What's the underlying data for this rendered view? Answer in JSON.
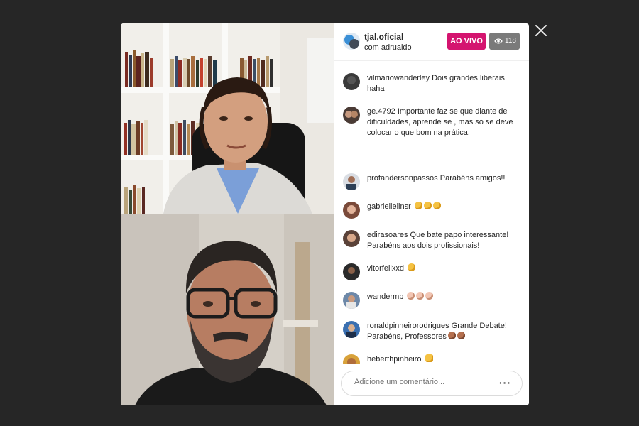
{
  "header": {
    "username": "tjal.oficial",
    "with_text": "com adrualdo",
    "live_label": "AO VIVO",
    "viewer_count": "118"
  },
  "comments": [
    {
      "user": "vilmariowanderley",
      "text": "Dois grandes liberais haha",
      "emoji": []
    },
    {
      "user": "ge.4792",
      "text": "Importante faz se que diante de dificuldades, aprende se , mas só se deve colocar o que bom na prática.",
      "emoji": []
    },
    {
      "user": "profandersonpassos",
      "text": "Parabéns amigos!!",
      "emoji": []
    },
    {
      "user": "gabriellelinsr",
      "text": "",
      "emoji": [
        "clap",
        "clap",
        "clap"
      ]
    },
    {
      "user": "edirasoares",
      "text": "Que bate papo interessante! Parabéns aos dois profissionais!",
      "emoji": []
    },
    {
      "user": "vitorfelixxd",
      "text": "",
      "emoji": [
        "clap"
      ]
    },
    {
      "user": "wandermb",
      "text": "",
      "emoji": [
        "clap-light",
        "clap-light",
        "clap-light"
      ]
    },
    {
      "user": "ronaldpinheirorodrigues",
      "text": "Grande Debate! Parabéns, Professores",
      "emoji": [
        "clap-dark",
        "clap-dark"
      ]
    },
    {
      "user": "heberthpinheiro",
      "text": "",
      "emoji": [
        "thumbs-up"
      ]
    }
  ],
  "input": {
    "placeholder": "Adicione um comentário..."
  },
  "icons": {
    "close": "close-icon",
    "viewers": "eye-icon",
    "more": "more-options-icon"
  },
  "colors": {
    "live": "#d4146f",
    "viewers_badge": "#7a7a7a",
    "backdrop": "#262626"
  }
}
